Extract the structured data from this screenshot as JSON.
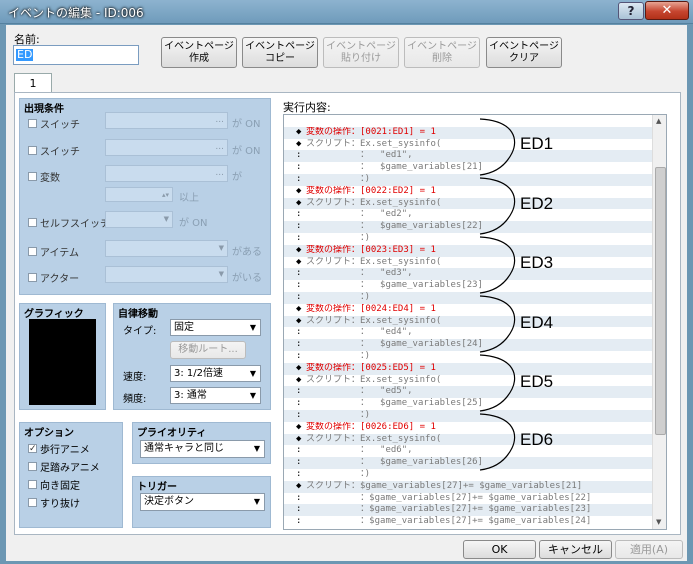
{
  "window": {
    "title": "イベントの編集 - ID:006",
    "help": "?",
    "close": "✕"
  },
  "name": {
    "label": "名前:",
    "value": "ED"
  },
  "toolbar": {
    "create": "イベントページ\n作成",
    "copy": "イベントページ\nコピー",
    "paste": "イベントページ\n貼り付け",
    "delete": "イベントページ\n削除",
    "clear": "イベントページ\nクリア"
  },
  "tab": {
    "label": "1"
  },
  "conditions": {
    "title": "出現条件",
    "switch1": "スイッチ",
    "switch2": "スイッチ",
    "variable": "変数",
    "self_switch": "セルフスイッチ",
    "item": "アイテム",
    "actor": "アクター",
    "on1": "が ON",
    "on2": "が ON",
    "ga": "が",
    "above": "以上",
    "on3": "が ON",
    "has": "がある",
    "present": "がいる",
    "ellipsis": "..."
  },
  "graphic": {
    "title": "グラフィック"
  },
  "autonomous": {
    "title": "自律移動",
    "type_label": "タイプ:",
    "type_value": "固定",
    "route_button": "移動ルート...",
    "speed_label": "速度:",
    "speed_value": "3: 1/2倍速",
    "freq_label": "頻度:",
    "freq_value": "3: 通常"
  },
  "options": {
    "title": "オプション",
    "walk": "歩行アニメ",
    "step": "足踏みアニメ",
    "dir_fix": "向き固定",
    "through": "すり抜け",
    "walk_checked": "✓"
  },
  "priority": {
    "title": "プライオリティ",
    "value": "通常キャラと同じ"
  },
  "trigger": {
    "title": "トリガー",
    "value": "決定ボタン"
  },
  "contents": {
    "label": "実行内容:",
    "lines": [
      {
        "mk": "",
        "text": "",
        "c": ""
      },
      {
        "mk": "◆",
        "text": "変数の操作：[0021:ED1] = 1",
        "c": "red"
      },
      {
        "mk": "◆",
        "text": "スクリプト：Ex.set_sysinfo(",
        "c": "gray"
      },
      {
        "mk": ":",
        "text": "          ：  \"ed1\",",
        "c": "gray"
      },
      {
        "mk": ":",
        "text": "          ：  $game_variables[21]",
        "c": "gray"
      },
      {
        "mk": ":",
        "text": "          ：)",
        "c": "gray"
      },
      {
        "mk": "◆",
        "text": "変数の操作：[0022:ED2] = 1",
        "c": "red"
      },
      {
        "mk": "◆",
        "text": "スクリプト：Ex.set_sysinfo(",
        "c": "gray"
      },
      {
        "mk": ":",
        "text": "          ：  \"ed2\",",
        "c": "gray"
      },
      {
        "mk": ":",
        "text": "          ：  $game_variables[22]",
        "c": "gray"
      },
      {
        "mk": ":",
        "text": "          ：)",
        "c": "gray"
      },
      {
        "mk": "◆",
        "text": "変数の操作：[0023:ED3] = 1",
        "c": "red"
      },
      {
        "mk": "◆",
        "text": "スクリプト：Ex.set_sysinfo(",
        "c": "gray"
      },
      {
        "mk": ":",
        "text": "          ：  \"ed3\",",
        "c": "gray"
      },
      {
        "mk": ":",
        "text": "          ：  $game_variables[23]",
        "c": "gray"
      },
      {
        "mk": ":",
        "text": "          ：)",
        "c": "gray"
      },
      {
        "mk": "◆",
        "text": "変数の操作：[0024:ED4] = 1",
        "c": "red"
      },
      {
        "mk": "◆",
        "text": "スクリプト：Ex.set_sysinfo(",
        "c": "gray"
      },
      {
        "mk": ":",
        "text": "          ：  \"ed4\",",
        "c": "gray"
      },
      {
        "mk": ":",
        "text": "          ：  $game_variables[24]",
        "c": "gray"
      },
      {
        "mk": ":",
        "text": "          ：)",
        "c": "gray"
      },
      {
        "mk": "◆",
        "text": "変数の操作：[0025:ED5] = 1",
        "c": "red"
      },
      {
        "mk": "◆",
        "text": "スクリプト：Ex.set_sysinfo(",
        "c": "gray"
      },
      {
        "mk": ":",
        "text": "          ：  \"ed5\",",
        "c": "gray"
      },
      {
        "mk": ":",
        "text": "          ：  $game_variables[25]",
        "c": "gray"
      },
      {
        "mk": ":",
        "text": "          ：)",
        "c": "gray"
      },
      {
        "mk": "◆",
        "text": "変数の操作：[0026:ED6] = 1",
        "c": "red"
      },
      {
        "mk": "◆",
        "text": "スクリプト：Ex.set_sysinfo(",
        "c": "gray"
      },
      {
        "mk": ":",
        "text": "          ：  \"ed6\",",
        "c": "gray"
      },
      {
        "mk": ":",
        "text": "          ：  $game_variables[26]",
        "c": "gray"
      },
      {
        "mk": ":",
        "text": "          ：)",
        "c": "gray"
      },
      {
        "mk": "◆",
        "text": "スクリプト：$game_variables[27]+= $game_variables[21]",
        "c": "gray"
      },
      {
        "mk": ":",
        "text": "          ：$game_variables[27]+= $game_variables[22]",
        "c": "gray"
      },
      {
        "mk": ":",
        "text": "          ：$game_variables[27]+= $game_variables[23]",
        "c": "gray"
      },
      {
        "mk": ":",
        "text": "          ：$game_variables[27]+= $game_variables[24]",
        "c": "gray"
      }
    ]
  },
  "annotations": [
    "ED1",
    "ED2",
    "ED3",
    "ED4",
    "ED5",
    "ED6"
  ],
  "footer": {
    "ok": "OK",
    "cancel": "キャンセル",
    "apply": "適用(A)"
  }
}
